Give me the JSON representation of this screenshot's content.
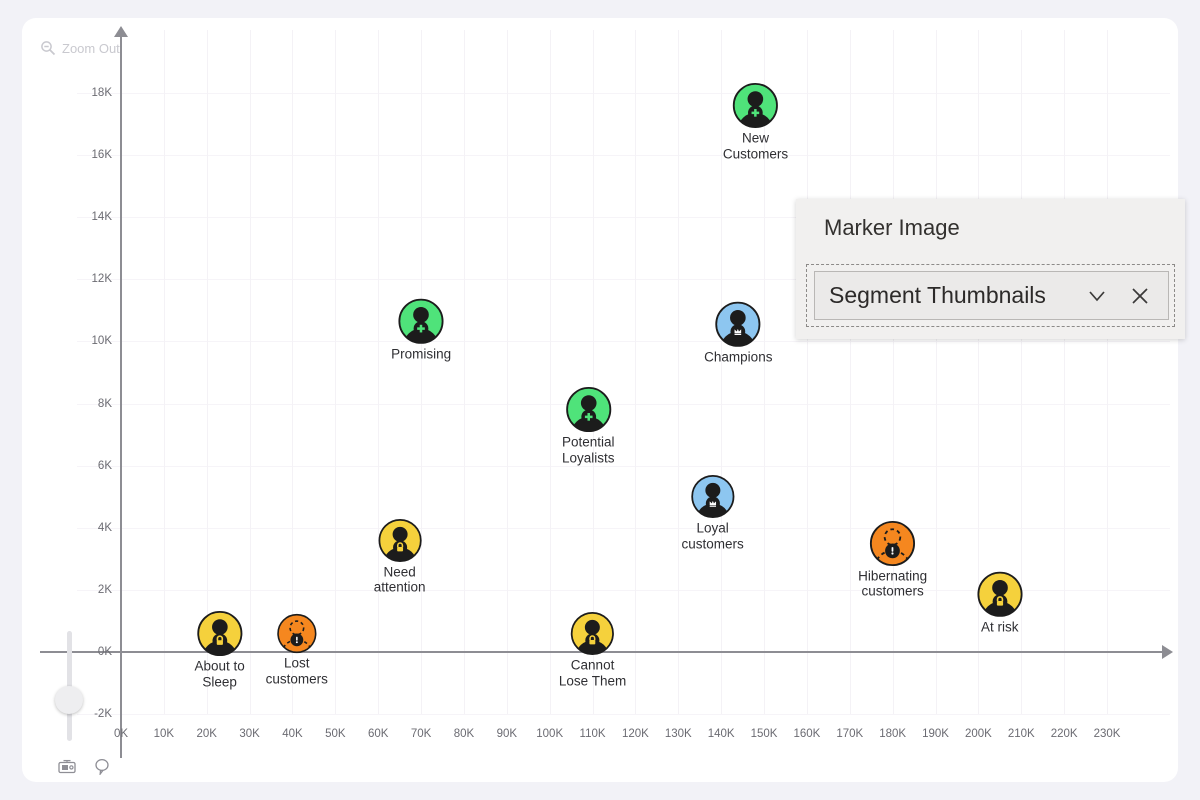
{
  "controls": {
    "zoom_out_label": "Zoom Out",
    "zoom_out_icon": "magnifier-minus-icon",
    "snapshot_icon": "camera-icon",
    "comment_icon": "speech-bubble-icon",
    "slider_name": "vertical-zoom-slider"
  },
  "panel": {
    "title": "Marker Image",
    "select_value": "Segment Thumbnails",
    "chevron_icon": "chevron-down-icon",
    "close_icon": "close-icon"
  },
  "chart_data": {
    "type": "scatter",
    "title": "",
    "xlabel": "",
    "ylabel": "",
    "xlim": [
      -5000,
      238000
    ],
    "ylim": [
      -2800,
      19000
    ],
    "grid": true,
    "legend": "none",
    "x_ticks": [
      "0K",
      "10K",
      "20K",
      "30K",
      "40K",
      "50K",
      "60K",
      "70K",
      "80K",
      "90K",
      "100K",
      "110K",
      "120K",
      "130K",
      "140K",
      "150K",
      "160K",
      "170K",
      "180K",
      "190K",
      "200K",
      "210K",
      "220K",
      "230K"
    ],
    "x_tick_values": [
      0,
      10000,
      20000,
      30000,
      40000,
      50000,
      60000,
      70000,
      80000,
      90000,
      100000,
      110000,
      120000,
      130000,
      140000,
      150000,
      160000,
      170000,
      180000,
      190000,
      200000,
      210000,
      220000,
      230000
    ],
    "y_ticks": [
      "18K",
      "16K",
      "14K",
      "12K",
      "10K",
      "8K",
      "6K",
      "4K",
      "2K",
      "0K",
      "-2K"
    ],
    "y_tick_values": [
      18000,
      16000,
      14000,
      12000,
      10000,
      8000,
      6000,
      4000,
      2000,
      0,
      -2000
    ],
    "points": [
      {
        "label": "New\nCustomers",
        "x": 148000,
        "y": 17000,
        "color": "#4fe37a",
        "badge": "plus",
        "silhouette": "solid",
        "size": 46
      },
      {
        "label": "Promising",
        "x": 70000,
        "y": 10300,
        "color": "#4fe37a",
        "badge": "plus",
        "silhouette": "solid",
        "size": 46
      },
      {
        "label": "Champions",
        "x": 144000,
        "y": 10200,
        "color": "#8dc6f0",
        "badge": "crown",
        "silhouette": "solid",
        "size": 46
      },
      {
        "label": "Potential\nLoyalists",
        "x": 109000,
        "y": 7200,
        "color": "#4fe37a",
        "badge": "plus",
        "silhouette": "solid",
        "size": 46
      },
      {
        "label": "Loyal\ncustomers",
        "x": 138000,
        "y": 4400,
        "color": "#8dc6f0",
        "badge": "crown",
        "silhouette": "solid",
        "size": 44
      },
      {
        "label": "Need\nattention",
        "x": 65000,
        "y": 3000,
        "color": "#f5d13c",
        "badge": "lock",
        "silhouette": "solid",
        "size": 44
      },
      {
        "label": "Hibernating\ncustomers",
        "x": 180000,
        "y": 2900,
        "color": "#f5871f",
        "badge": "exclaim",
        "silhouette": "dashed",
        "size": 46
      },
      {
        "label": "At risk",
        "x": 205000,
        "y": 1500,
        "color": "#f5d13c",
        "badge": "lock",
        "silhouette": "solid",
        "size": 46
      },
      {
        "label": "About to\nSleep",
        "x": 23000,
        "y": 0,
        "color": "#f5d13c",
        "badge": "lock",
        "silhouette": "solid",
        "size": 46
      },
      {
        "label": "Lost\ncustomers",
        "x": 41000,
        "y": 0,
        "color": "#f5871f",
        "badge": "exclaim",
        "silhouette": "dashed",
        "size": 40
      },
      {
        "label": "Cannot\nLose Them",
        "x": 110000,
        "y": 0,
        "color": "#f5d13c",
        "badge": "lock",
        "silhouette": "solid",
        "size": 44
      }
    ]
  }
}
